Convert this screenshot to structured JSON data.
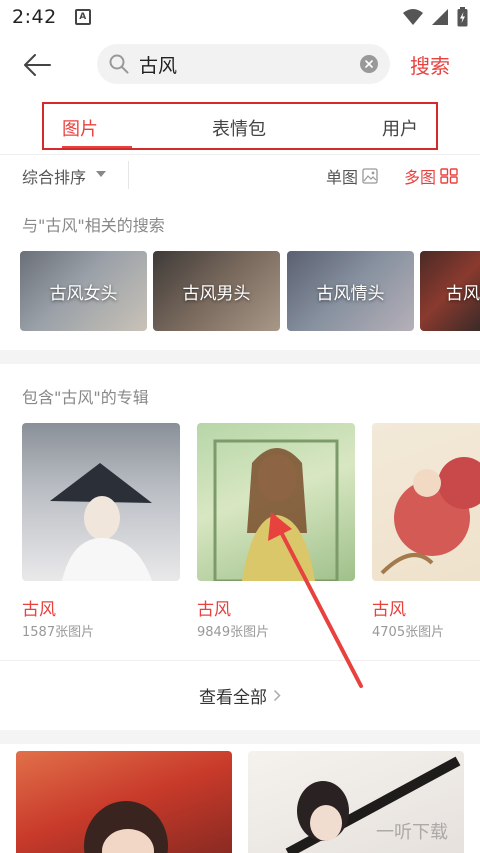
{
  "status_bar": {
    "time": "2:42",
    "notification": "A"
  },
  "header": {
    "search_value": "古风",
    "search_action": "搜索"
  },
  "tabs": [
    {
      "label": "图片",
      "active": true
    },
    {
      "label": "表情包",
      "active": false
    },
    {
      "label": "用户",
      "active": false
    }
  ],
  "sort": {
    "label": "综合排序",
    "single_view": "单图",
    "multi_view": "多图"
  },
  "related": {
    "title": "与\"古风\"相关的搜索",
    "items": [
      "古风女头",
      "古风男头",
      "古风情头",
      "古风"
    ]
  },
  "albums": {
    "title": "包含\"古风\"的专辑",
    "items": [
      {
        "name": "古风",
        "count": "1587张图片"
      },
      {
        "name": "古风",
        "count": "9849张图片"
      },
      {
        "name": "古风",
        "count": "4705张图片"
      }
    ],
    "view_all": "查看全部"
  },
  "watermark": "一听下载",
  "colors": {
    "accent": "#e8423f",
    "annotation_red": "#d42a2a"
  }
}
